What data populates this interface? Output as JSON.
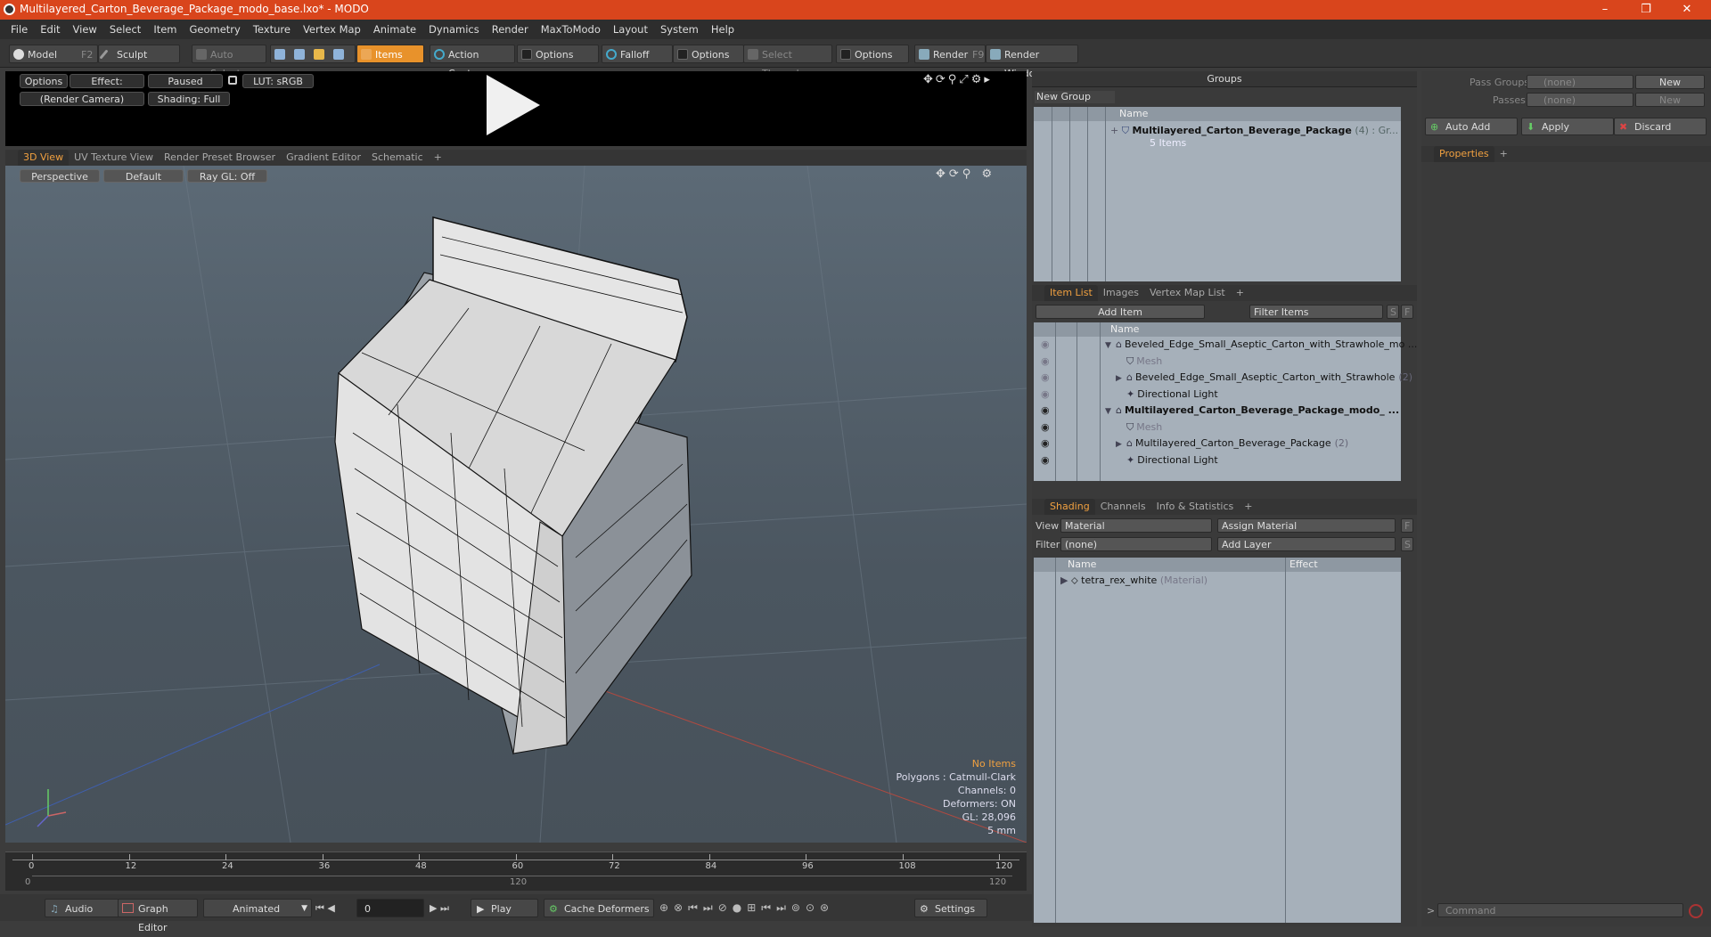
{
  "window": {
    "title": "Multilayered_Carton_Beverage_Package_modo_base.lxo* - MODO",
    "minimize": "–",
    "restore": "❐",
    "close": "✕"
  },
  "menu": [
    "File",
    "Edit",
    "View",
    "Select",
    "Item",
    "Geometry",
    "Texture",
    "Vertex Map",
    "Animate",
    "Dynamics",
    "Render",
    "MaxToModo",
    "Layout",
    "System",
    "Help"
  ],
  "toolbar": {
    "model": "Model",
    "model_key": "F2",
    "sculpt": "Sculpt",
    "auto_select": "Auto Select",
    "items": "Items",
    "action_center": "Action Center",
    "options": "Options",
    "falloff": "Falloff",
    "select_through": "Select Through",
    "render": "Render",
    "render_key": "F9",
    "render_window": "Render Window"
  },
  "preview": {
    "options": "Options",
    "effect": "Effect: (Shadi...",
    "paused": "Paused",
    "lut": "LUT: sRGB",
    "camera": "(Render Camera)",
    "shading": "Shading: Full"
  },
  "view_tabs": [
    "3D View",
    "UV Texture View",
    "Render Preset Browser",
    "Gradient Editor",
    "Schematic",
    "+"
  ],
  "viewport": {
    "perspective": "Perspective",
    "default": "Default",
    "raygl": "Ray GL: Off"
  },
  "info": {
    "no_items": "No Items",
    "polygons": "Polygons : Catmull-Clark",
    "channels": "Channels: 0",
    "deformers": "Deformers: ON",
    "gl": "GL: 28,096",
    "units": "5 mm"
  },
  "timeline": {
    "ticks": [
      "0",
      "12",
      "24",
      "36",
      "48",
      "60",
      "72",
      "84",
      "96",
      "108",
      "120"
    ],
    "low": "0",
    "mid": "120",
    "high": "120"
  },
  "bottom": {
    "audio": "Audio",
    "graph_editor": "Graph Editor",
    "animated": "Animated",
    "frame": "0",
    "play": "Play",
    "cache_deformers": "Cache Deformers",
    "settings": "Settings"
  },
  "groups": {
    "title": "Groups",
    "new_group": "New Group",
    "col_name": "Name",
    "item_name": "Multilayered_Carton_Beverage_Package",
    "item_count": "(4)",
    "item_suffix": ": Gr...",
    "item_sub": "5 Items"
  },
  "item_tabs": [
    "Item List",
    "Images",
    "Vertex Map List",
    "+"
  ],
  "itemlist": {
    "add_item": "Add Item",
    "filter": "Filter Items",
    "s": "S",
    "f": "F",
    "col_name": "Name",
    "rows": [
      {
        "label": "Beveled_Edge_Small_Aseptic_Carton_with_Strawhole_mo ...",
        "bold": false,
        "indent": 0,
        "arrow": "▼"
      },
      {
        "label": "Mesh",
        "bold": false,
        "indent": 1,
        "arrow": "",
        "dim": true
      },
      {
        "label": "Beveled_Edge_Small_Aseptic_Carton_with_Strawhole",
        "count": "(2)",
        "bold": false,
        "indent": 1,
        "arrow": "▶"
      },
      {
        "label": "Directional Light",
        "bold": false,
        "indent": 1,
        "arrow": ""
      },
      {
        "label": "Multilayered_Carton_Beverage_Package_modo_ ...",
        "bold": true,
        "indent": 0,
        "arrow": "▼"
      },
      {
        "label": "Mesh",
        "bold": false,
        "indent": 1,
        "arrow": "",
        "dim": true
      },
      {
        "label": "Multilayered_Carton_Beverage_Package",
        "count": "(2)",
        "bold": false,
        "indent": 1,
        "arrow": "▶"
      },
      {
        "label": "Directional Light",
        "bold": false,
        "indent": 1,
        "arrow": ""
      }
    ]
  },
  "shading_tabs": [
    "Shading",
    "Channels",
    "Info & Statistics",
    "+"
  ],
  "shading": {
    "view_label": "View",
    "view_value": "Material",
    "assign": "Assign Material",
    "filter_label": "Filter",
    "filter_value": "(none)",
    "add_layer": "Add Layer",
    "f": "F",
    "s": "S",
    "col_name": "Name",
    "col_effect": "Effect",
    "material": "tetra_rex_white",
    "material_type": "(Material)"
  },
  "right": {
    "pass_groups": "Pass Groups",
    "passes": "Passes",
    "none": "(none)",
    "new": "New",
    "auto_add": "Auto Add",
    "apply": "Apply",
    "discard": "Discard",
    "properties": "Properties",
    "plus": "+",
    "command": "Command"
  }
}
